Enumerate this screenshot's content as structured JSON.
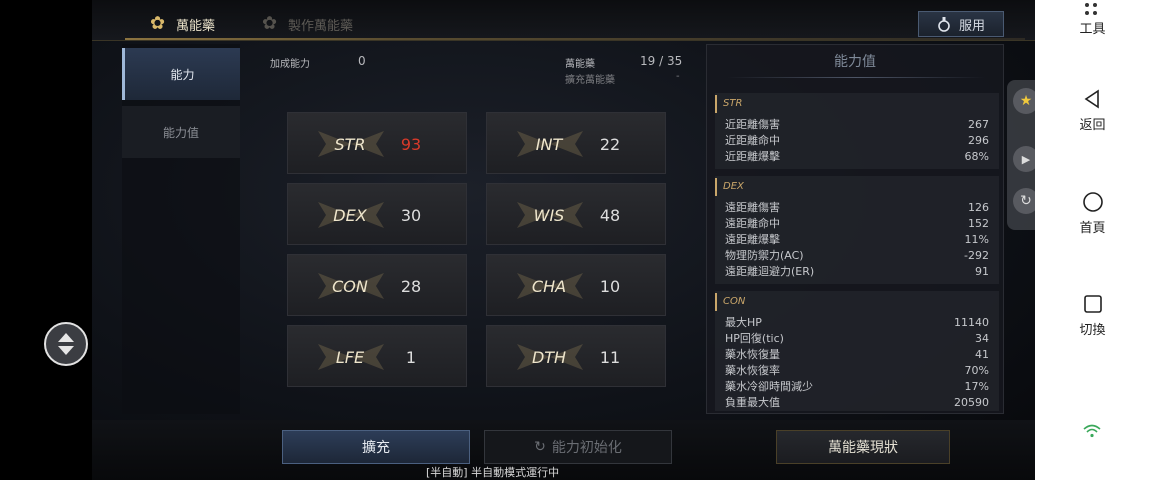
{
  "tabs": {
    "active_label": "萬能藥",
    "inactive_label": "製作萬能藥",
    "use_button": "服用"
  },
  "sidebar": {
    "items": [
      {
        "label": "能力"
      },
      {
        "label": "能力值"
      }
    ]
  },
  "header": {
    "bonus_label": "加成能力",
    "bonus_value": "0",
    "elixir_label": "萬能藥",
    "elixir_value": "19 / 35",
    "expand_label": "擴充萬能藥",
    "expand_value": "-"
  },
  "stats": [
    {
      "name": "STR",
      "value": "93",
      "highlight": true
    },
    {
      "name": "INT",
      "value": "22"
    },
    {
      "name": "DEX",
      "value": "30"
    },
    {
      "name": "WIS",
      "value": "48"
    },
    {
      "name": "CON",
      "value": "28"
    },
    {
      "name": "CHA",
      "value": "10"
    },
    {
      "name": "LFE",
      "value": "1"
    },
    {
      "name": "DTH",
      "value": "11"
    }
  ],
  "ability_panel": {
    "title": "能力值",
    "sections": [
      {
        "name": "STR",
        "rows": [
          {
            "label": "近距離傷害",
            "value": "267"
          },
          {
            "label": "近距離命中",
            "value": "296"
          },
          {
            "label": "近距離爆擊",
            "value": "68%"
          }
        ]
      },
      {
        "name": "DEX",
        "rows": [
          {
            "label": "遠距離傷害",
            "value": "126"
          },
          {
            "label": "遠距離命中",
            "value": "152"
          },
          {
            "label": "遠距離爆擊",
            "value": "11%"
          },
          {
            "label": "物理防禦力(AC)",
            "value": "-292"
          },
          {
            "label": "遠距離迴避力(ER)",
            "value": "91"
          }
        ]
      },
      {
        "name": "CON",
        "rows": [
          {
            "label": "最大HP",
            "value": "11140"
          },
          {
            "label": "HP回復(tic)",
            "value": "34"
          },
          {
            "label": "藥水恢復量",
            "value": "41"
          },
          {
            "label": "藥水恢復率",
            "value": "70%"
          },
          {
            "label": "藥水冷卻時間減少",
            "value": "17%"
          },
          {
            "label": "負重最大值",
            "value": "20590"
          }
        ]
      }
    ]
  },
  "bottom": {
    "expand_button": "擴充",
    "reset_button": "能力初始化",
    "status_button": "萬能藥現狀",
    "status_line": "[半自動] 半自動模式運行中"
  },
  "android_nav": {
    "tools": "工具",
    "back": "返回",
    "home": "首頁",
    "switch": "切換"
  },
  "colors": {
    "accent_gold": "#c9a66a",
    "highlight_red": "#d83a2a",
    "active_blue": "#2c3a52"
  }
}
